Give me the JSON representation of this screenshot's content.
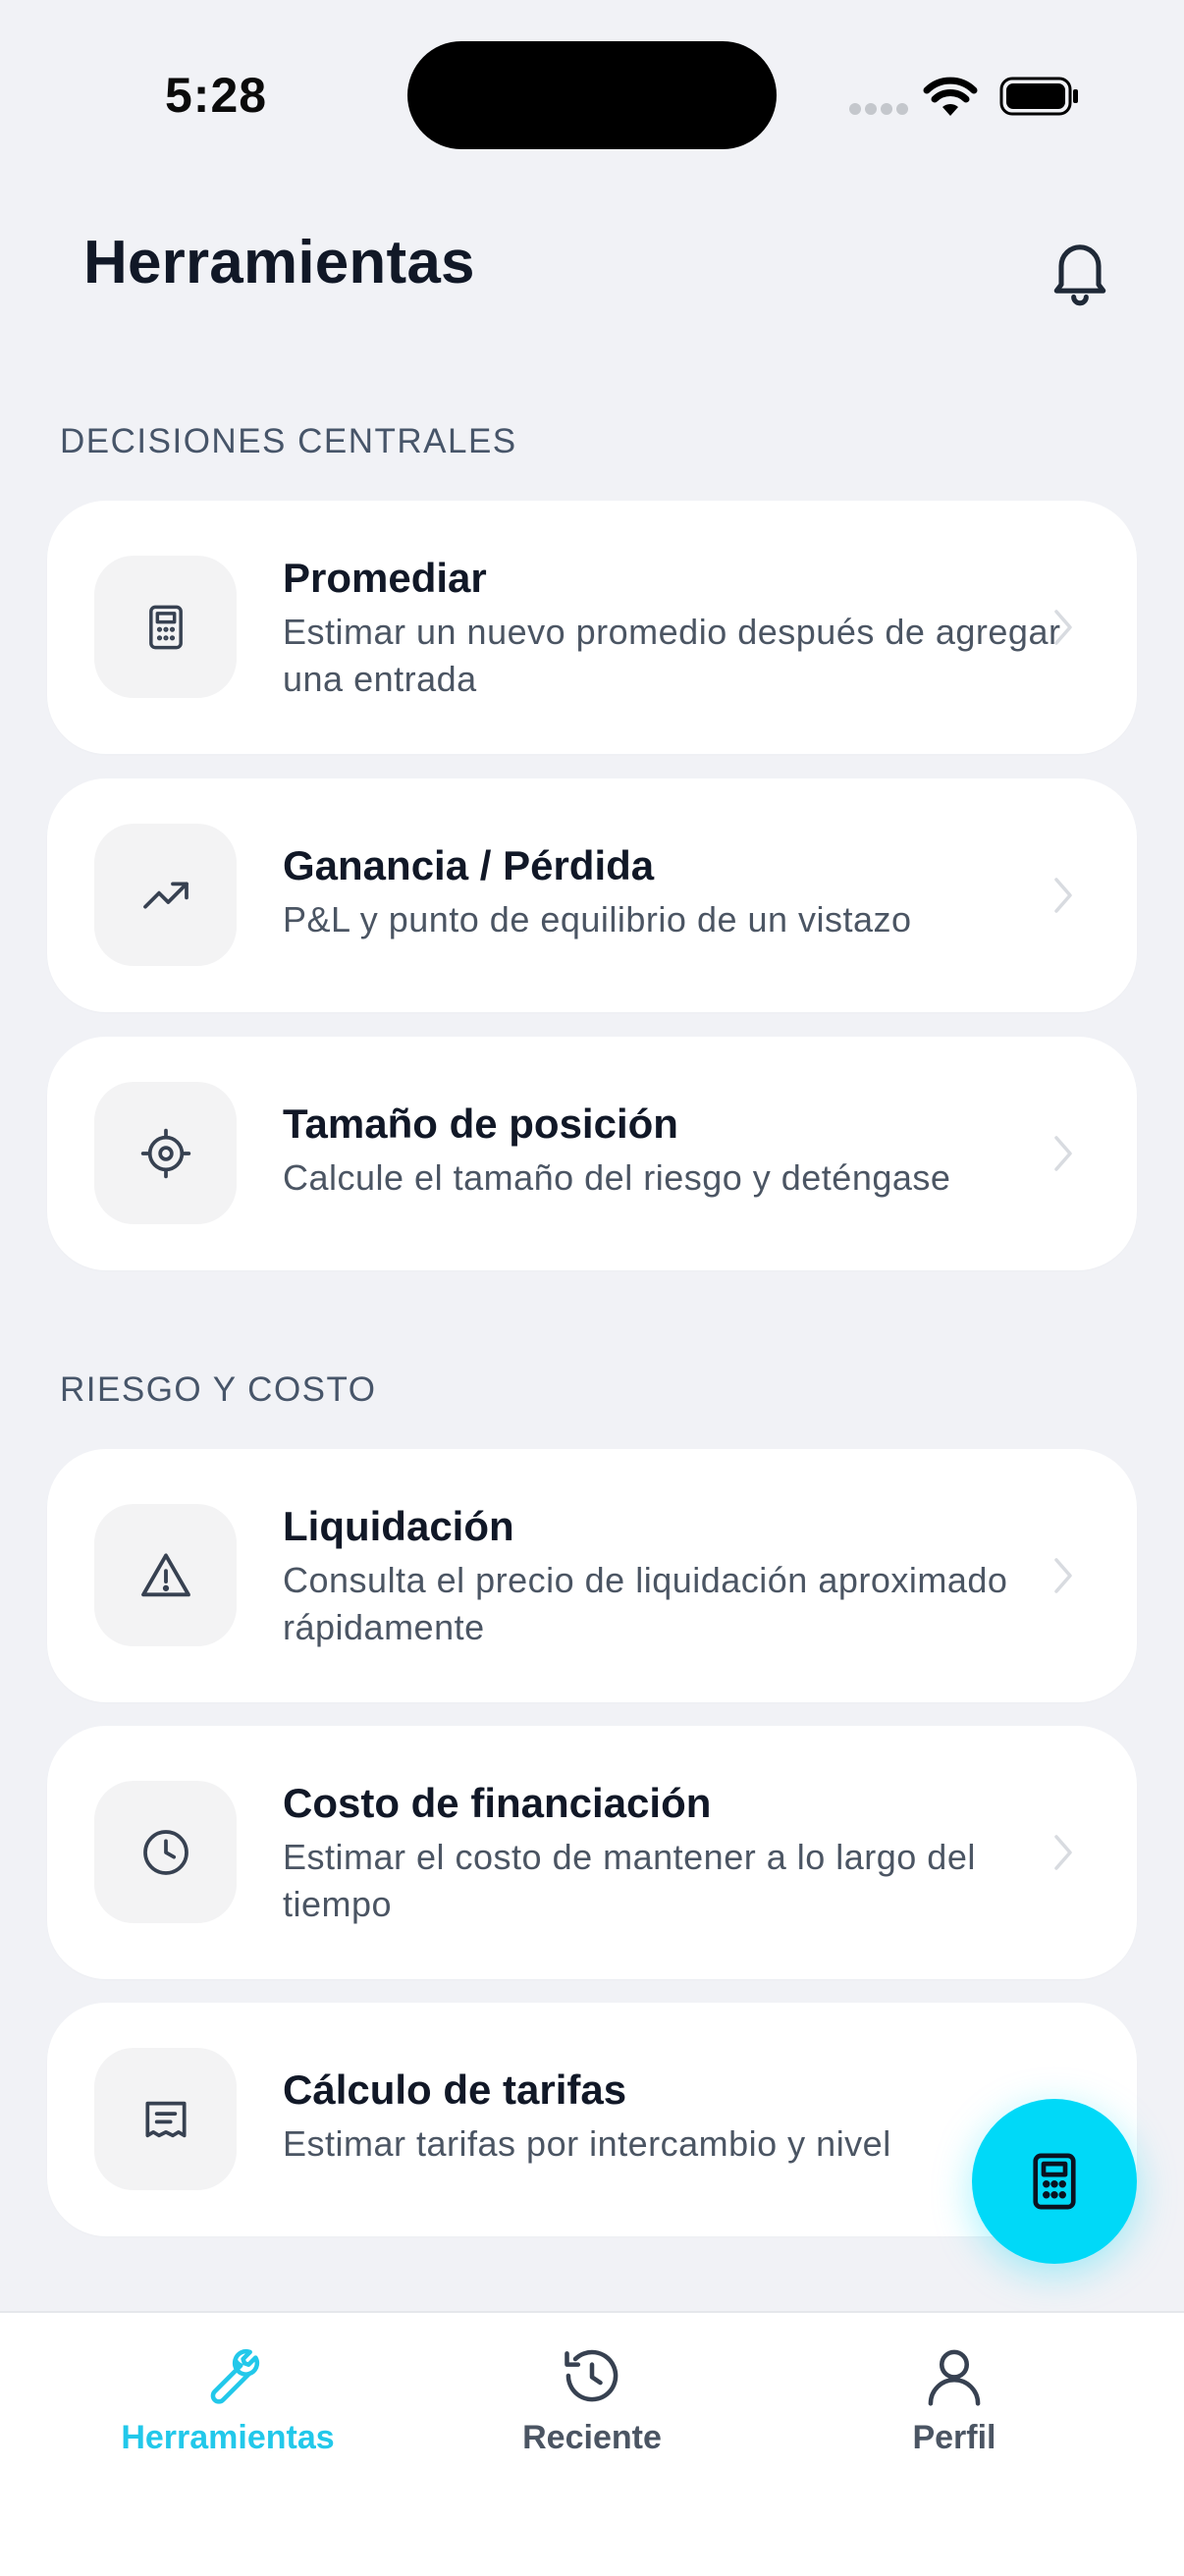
{
  "status_bar": {
    "time": "5:28"
  },
  "header": {
    "title": "Herramientas"
  },
  "sections": [
    {
      "label": "DECISIONES CENTRALES",
      "items": [
        {
          "title": "Promediar",
          "subtitle": "Estimar un nuevo promedio después de agregar una entrada",
          "icon": "calculator-icon"
        },
        {
          "title": "Ganancia / Pérdida",
          "subtitle": "P&L y punto de equilibrio de un vistazo",
          "icon": "trending-up-icon"
        },
        {
          "title": "Tamaño de posición",
          "subtitle": "Calcule el tamaño del riesgo y deténgase",
          "icon": "crosshair-icon"
        }
      ]
    },
    {
      "label": "RIESGO Y COSTO",
      "items": [
        {
          "title": "Liquidación",
          "subtitle": "Consulta el precio de liquidación aproximado rápidamente",
          "icon": "warning-icon"
        },
        {
          "title": "Costo de financiación",
          "subtitle": "Estimar el costo de mantener a lo largo del tiempo",
          "icon": "clock-icon"
        },
        {
          "title": "Cálculo de tarifas",
          "subtitle": "Estimar tarifas por intercambio y nivel",
          "icon": "receipt-icon"
        }
      ]
    }
  ],
  "fab": {
    "icon": "calculator-icon"
  },
  "nav": {
    "items": [
      {
        "label": "Herramientas",
        "icon": "wrench-icon",
        "active": true
      },
      {
        "label": "Reciente",
        "icon": "history-icon",
        "active": false
      },
      {
        "label": "Perfil",
        "icon": "user-icon",
        "active": false
      }
    ]
  },
  "colors": {
    "accent": "#00d9f8",
    "active_nav": "#22c8ea",
    "inactive_nav": "#4b5563"
  }
}
